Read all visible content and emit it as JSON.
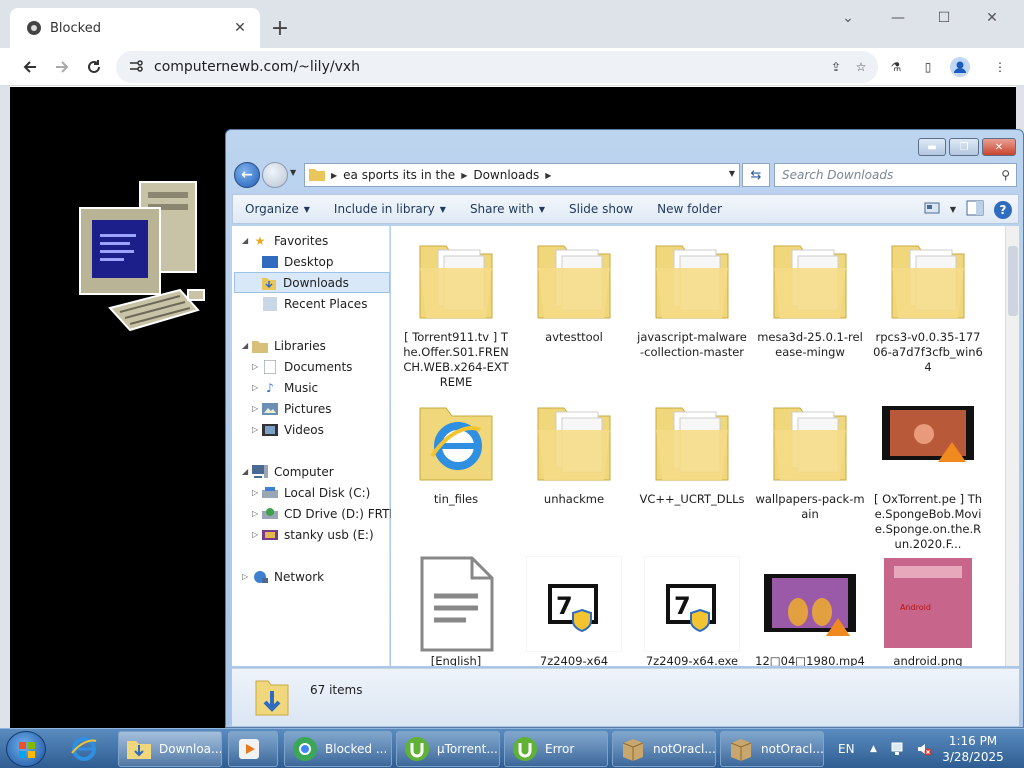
{
  "browser": {
    "tab_title": "Blocked",
    "url": "computernewb.com/~lily/vxh"
  },
  "explorer": {
    "breadcrumb": [
      "ea sports its in the",
      "Downloads"
    ],
    "search_placeholder": "Search Downloads",
    "commands": [
      "Organize",
      "Include in library",
      "Share with",
      "Slide show",
      "New folder"
    ],
    "nav": {
      "favorites": "Favorites",
      "desktop": "Desktop",
      "downloads": "Downloads",
      "recent": "Recent Places",
      "libraries": "Libraries",
      "documents": "Documents",
      "music": "Music",
      "pictures": "Pictures",
      "videos": "Videos",
      "computer": "Computer",
      "local_disk": "Local Disk (C:)",
      "cd_drive": "CD Drive (D:) FRTME",
      "usb": "stanky usb (E:)",
      "network": "Network"
    },
    "files": [
      {
        "name": "[ Torrent911.tv ] The.Offer.S01.FRENCH.WEB.x264-EXTREME",
        "kind": "folder"
      },
      {
        "name": "avtesttool",
        "kind": "folder"
      },
      {
        "name": "javascript-malware-collection-master",
        "kind": "folder"
      },
      {
        "name": "mesa3d-25.0.1-release-mingw",
        "kind": "folder"
      },
      {
        "name": "rpcs3-v0.0.35-17706-a7d7f3cfb_win64",
        "kind": "folder"
      },
      {
        "name": "tin_files",
        "kind": "folder-ie"
      },
      {
        "name": "unhackme",
        "kind": "folder"
      },
      {
        "name": "VC++_UCRT_DLLs",
        "kind": "folder"
      },
      {
        "name": "wallpapers-pack-main",
        "kind": "folder"
      },
      {
        "name": "[ OxTorrent.pe ] The.SpongeBob.Movie.Sponge.on.the.Run.2020.F...",
        "kind": "video"
      },
      {
        "name": "[English]",
        "kind": "document"
      },
      {
        "name": "7z2409-x64",
        "kind": "7z"
      },
      {
        "name": "7z2409-x64.exe",
        "kind": "7z"
      },
      {
        "name": "12□04□1980.mp4",
        "kind": "video2"
      },
      {
        "name": "android.png",
        "kind": "image"
      }
    ],
    "item_count": "67 items"
  },
  "taskbar": {
    "tasks": [
      "Downloa...",
      "Blocked ...",
      "µTorrent...",
      "Error",
      "notOracl...",
      "notOracl..."
    ],
    "lang": "EN",
    "time": "1:16 PM",
    "date": "3/28/2025"
  }
}
